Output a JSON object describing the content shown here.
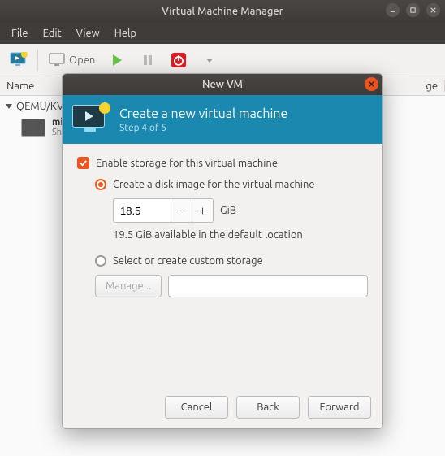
{
  "window": {
    "title": "Virtual Machine Manager"
  },
  "menubar": {
    "items": [
      "File",
      "Edit",
      "View",
      "Help"
    ]
  },
  "toolbar": {
    "open_label": "Open"
  },
  "list": {
    "header_name": "Name",
    "header_usage_suffix": "ge",
    "group": "QEMU/KV",
    "vm_name": "mi",
    "vm_status": "Shu"
  },
  "dialog": {
    "title": "New VM",
    "header_title": "Create a new virtual machine",
    "header_step": "Step 4 of 5",
    "enable_storage": "Enable storage for this virtual machine",
    "radio_create": "Create a disk image for the virtual machine",
    "size_value": "18.5",
    "size_unit": "GiB",
    "available": "19.5 GiB available in the default location",
    "radio_custom": "Select or create custom storage",
    "manage_label": "Manage...",
    "buttons": {
      "cancel": "Cancel",
      "back": "Back",
      "forward": "Forward"
    }
  }
}
